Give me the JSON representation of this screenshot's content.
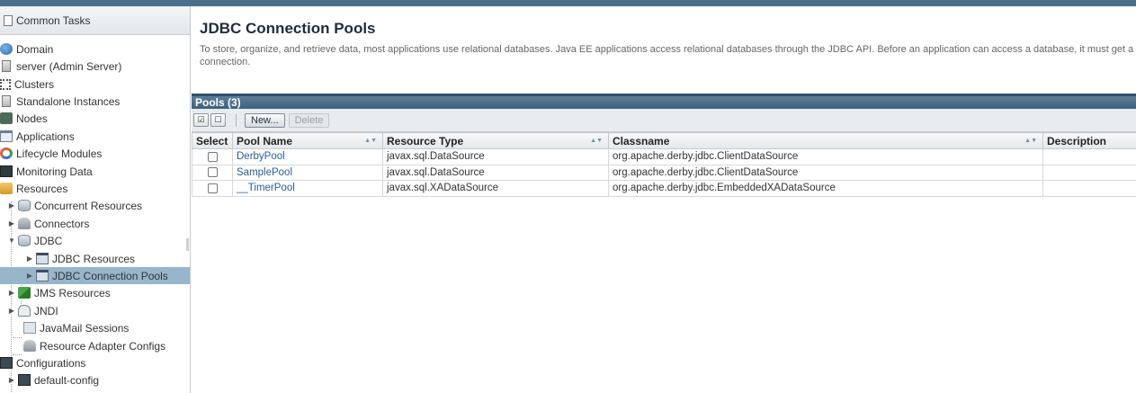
{
  "sidebar": {
    "header": "Common Tasks",
    "items": [
      {
        "label": "Domain",
        "icon": "globe-icon"
      },
      {
        "label": "server (Admin Server)",
        "icon": "server-icon"
      },
      {
        "label": "Clusters",
        "icon": "clusters-icon"
      },
      {
        "label": "Standalone Instances",
        "icon": "server-icon"
      },
      {
        "label": "Nodes",
        "icon": "nodes-icon"
      },
      {
        "label": "Applications",
        "icon": "applications-icon"
      },
      {
        "label": "Lifecycle Modules",
        "icon": "lifecycle-icon"
      },
      {
        "label": "Monitoring Data",
        "icon": "monitor-icon"
      },
      {
        "label": "Resources",
        "icon": "resources-icon"
      },
      {
        "label": "Concurrent Resources",
        "icon": "database-icon"
      },
      {
        "label": "Connectors",
        "icon": "connector-icon"
      },
      {
        "label": "JDBC",
        "icon": "database-icon"
      },
      {
        "label": "JDBC Resources",
        "icon": "folder-icon"
      },
      {
        "label": "JDBC Connection Pools",
        "icon": "folder-icon"
      },
      {
        "label": "JMS Resources",
        "icon": "jms-icon"
      },
      {
        "label": "JNDI",
        "icon": "jndi-icon"
      },
      {
        "label": "JavaMail Sessions",
        "icon": "mail-icon"
      },
      {
        "label": "Resource Adapter Configs",
        "icon": "adapter-icon"
      },
      {
        "label": "Configurations",
        "icon": "config-icon"
      },
      {
        "label": "default-config",
        "icon": "config-icon"
      }
    ]
  },
  "main": {
    "title": "JDBC Connection Pools",
    "help": "To store, organize, and retrieve data, most applications use relational databases. Java EE applications access relational databases through the JDBC API. Before an application can access a database, it must get a connection.",
    "table": {
      "title": "Pools (3)",
      "toolbar": {
        "new_label": "New...",
        "delete_label": "Delete"
      },
      "columns": [
        "Select",
        "Pool Name",
        "Resource Type",
        "Classname",
        "Description"
      ],
      "rows": [
        {
          "pool_name": "DerbyPool",
          "resource_type": "javax.sql.DataSource",
          "classname": "org.apache.derby.jdbc.ClientDataSource",
          "description": ""
        },
        {
          "pool_name": "SamplePool",
          "resource_type": "javax.sql.DataSource",
          "classname": "org.apache.derby.jdbc.ClientDataSource",
          "description": ""
        },
        {
          "pool_name": "__TimerPool",
          "resource_type": "javax.sql.XADataSource",
          "classname": "org.apache.derby.jdbc.EmbeddedXADataSource",
          "description": ""
        }
      ]
    }
  },
  "colors": {
    "selected_row": "#97b6cc",
    "header_bar": "#4a6f8c",
    "link": "#2c5c95"
  }
}
